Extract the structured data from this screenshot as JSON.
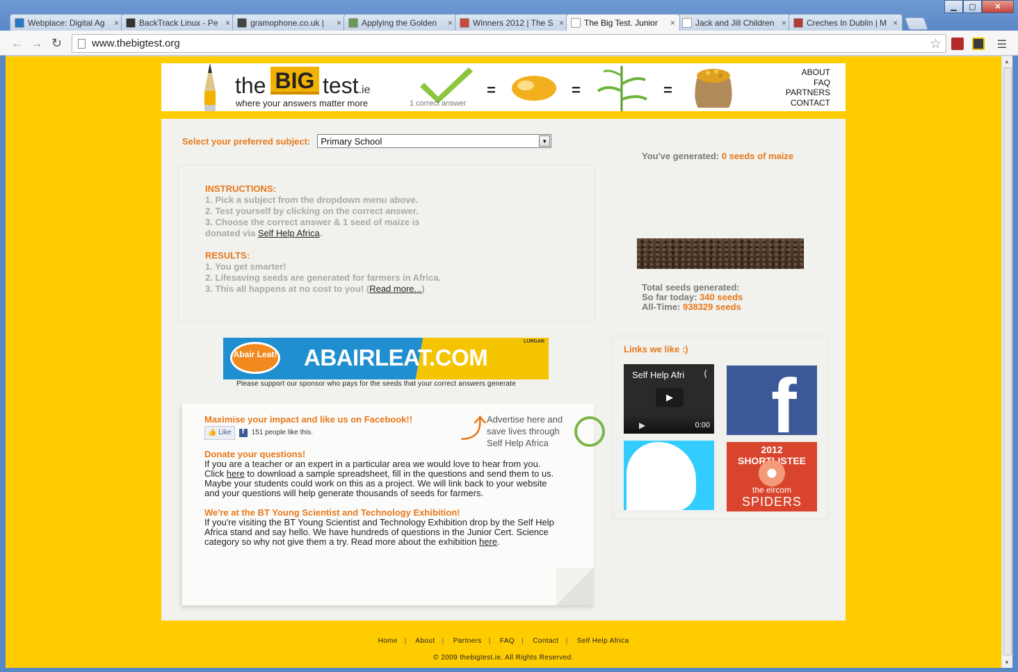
{
  "browser": {
    "tabs": [
      {
        "title": "Webplace: Digital Ag",
        "color": "#2a79c8"
      },
      {
        "title": "BackTrack Linux - Pe",
        "color": "#333333"
      },
      {
        "title": "gramophone.co.uk |",
        "color": "#444444"
      },
      {
        "title": "Applying the Golden",
        "color": "#6a9a5a"
      },
      {
        "title": "Winners 2012 | The S",
        "color": "#c84a3a"
      },
      {
        "title": "The Big Test. Junior",
        "color": "#ffffff"
      },
      {
        "title": "Jack and Jill Children",
        "color": "#ffffff"
      },
      {
        "title": "Creches In Dublin | M",
        "color": "#b23a3a"
      }
    ],
    "url": "www.thebigtest.org"
  },
  "header": {
    "logo_the": "the",
    "logo_big": "BIG",
    "logo_test": "test",
    "logo_ie": ".ie",
    "tagline": "where your answers matter more",
    "check_caption": "1 correct answer",
    "equals": "=",
    "nav": [
      "ABOUT",
      "FAQ",
      "PARTNERS",
      "CONTACT"
    ]
  },
  "subject": {
    "label": "Select your preferred subject:",
    "selected": "Primary School"
  },
  "instructions": {
    "heading": "INSTRUCTIONS:",
    "line1": "1. Pick a subject from the dropdown menu above.",
    "line2": "2. Test yourself by clicking on the correct answer.",
    "line3": "3. Choose the correct answer & 1 seed of maize is",
    "line4_prefix": "donated via ",
    "line4_link": "Self Help Africa",
    "line4_suffix": ".",
    "results_heading": "RESULTS:",
    "r1": "1. You get smarter!",
    "r2": "2. Lifesaving seeds are generated for farmers in Africa.",
    "r3_prefix": "3. This all happens at no cost to you! (",
    "r3_link": "Read more...",
    "r3_suffix": ")"
  },
  "generated": {
    "prefix": "You've generated: ",
    "value": "0 seeds of maize"
  },
  "totals": {
    "heading": "Total seeds generated:",
    "today_label": "So far today: ",
    "today_value": "340 seeds",
    "alltime_label": "All-Time: ",
    "alltime_value": "938329 seeds"
  },
  "sponsor": {
    "bubble": "Abair Leat!",
    "text": "ABAIRLEAT.COM",
    "tag": "LURGAN",
    "caption": "Please support our sponsor who pays for the seeds that your correct answers generate"
  },
  "facebook": {
    "heading": "Maximise your impact and like us on Facebook!!",
    "like_label": "Like",
    "like_count": "151 people like this."
  },
  "advertise": {
    "l1": "Advertise here and",
    "l2": "save lives through",
    "l3": "Self Help Africa"
  },
  "donate": {
    "heading": "Donate your questions!",
    "p1": "If you are a teacher or an expert in a particular area we would love to hear from you.",
    "p2_prefix": "Click ",
    "p2_link": "here",
    "p2_suffix": " to download a sample spreadsheet, fill in the questions and send them to us.",
    "p3": "Maybe your students could work on this as a project. We will link back to your website",
    "p4": "and your questions will help generate thousands of seeds for farmers."
  },
  "exhibition": {
    "heading": "We're at the BT Young Scientist and Technology Exhibition!",
    "p1": "If you're visiting the BT Young Scientist and Technology Exhibition drop by the Self Help",
    "p2": "Africa stand and say hello. We have hundreds of questions in the Junior Cert. Science",
    "p3_prefix": "category so why not give them a try. Read more about the exhibition ",
    "p3_link": "here",
    "p3_suffix": "."
  },
  "links": {
    "title": "Links we like :)",
    "video_title": "Self Help Afri",
    "video_time": "0:00",
    "spider_top": "2012 SHORTLISTEE",
    "spider_eircom": "the eircom",
    "spider_word": "SPIDERS"
  },
  "footer": {
    "links": [
      "Home",
      "About",
      "Partners",
      "FAQ",
      "Contact",
      "Self Help Africa"
    ],
    "copyright": "© 2009 thebigtest.ie. All Rights Reserved."
  }
}
